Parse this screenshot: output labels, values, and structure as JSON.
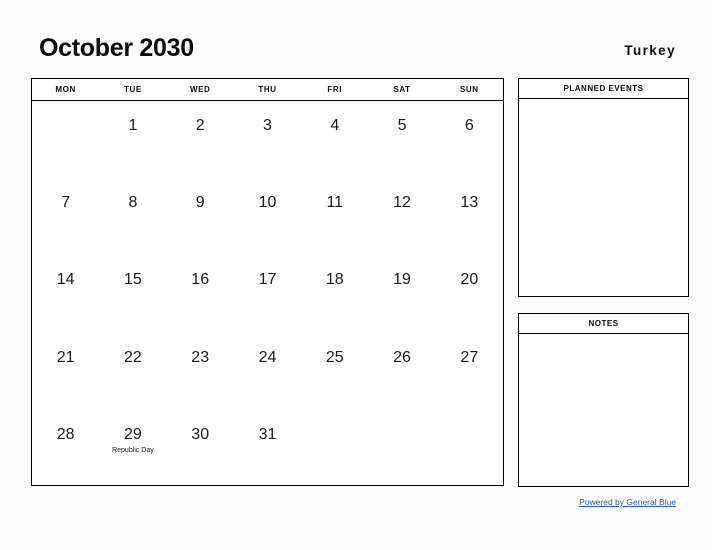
{
  "header": {
    "title": "October 2030",
    "country": "Turkey"
  },
  "calendar": {
    "weekdays": [
      "MON",
      "TUE",
      "WED",
      "THU",
      "FRI",
      "SAT",
      "SUN"
    ],
    "weeks": [
      [
        {
          "day": "",
          "event": ""
        },
        {
          "day": "1",
          "event": ""
        },
        {
          "day": "2",
          "event": ""
        },
        {
          "day": "3",
          "event": ""
        },
        {
          "day": "4",
          "event": ""
        },
        {
          "day": "5",
          "event": ""
        },
        {
          "day": "6",
          "event": ""
        }
      ],
      [
        {
          "day": "7",
          "event": ""
        },
        {
          "day": "8",
          "event": ""
        },
        {
          "day": "9",
          "event": ""
        },
        {
          "day": "10",
          "event": ""
        },
        {
          "day": "11",
          "event": ""
        },
        {
          "day": "12",
          "event": ""
        },
        {
          "day": "13",
          "event": ""
        }
      ],
      [
        {
          "day": "14",
          "event": ""
        },
        {
          "day": "15",
          "event": ""
        },
        {
          "day": "16",
          "event": ""
        },
        {
          "day": "17",
          "event": ""
        },
        {
          "day": "18",
          "event": ""
        },
        {
          "day": "19",
          "event": ""
        },
        {
          "day": "20",
          "event": ""
        }
      ],
      [
        {
          "day": "21",
          "event": ""
        },
        {
          "day": "22",
          "event": ""
        },
        {
          "day": "23",
          "event": ""
        },
        {
          "day": "24",
          "event": ""
        },
        {
          "day": "25",
          "event": ""
        },
        {
          "day": "26",
          "event": ""
        },
        {
          "day": "27",
          "event": ""
        }
      ],
      [
        {
          "day": "28",
          "event": ""
        },
        {
          "day": "29",
          "event": "Republic Day"
        },
        {
          "day": "30",
          "event": ""
        },
        {
          "day": "31",
          "event": ""
        },
        {
          "day": "",
          "event": ""
        },
        {
          "day": "",
          "event": ""
        },
        {
          "day": "",
          "event": ""
        }
      ]
    ]
  },
  "panels": {
    "planned_events_title": "PLANNED EVENTS",
    "notes_title": "NOTES"
  },
  "footer": {
    "link_text": "Powered by General Blue"
  },
  "colors": {
    "link": "#2a55c8",
    "border": "#000000",
    "text": "#111111",
    "background": "#fdfdfd"
  }
}
